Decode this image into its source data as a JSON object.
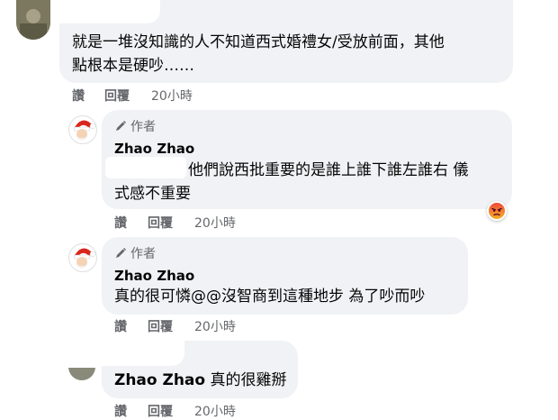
{
  "comments": [
    {
      "text_line1": "就是一堆沒知識的人不知道西式婚禮女/受放前面，其他",
      "text_line2": "點根本是硬吵……",
      "like": "讚",
      "reply": "回覆",
      "time": "20小時"
    },
    {
      "badge": "作者",
      "author": "Zhao Zhao",
      "text_line1": "他們說西批重要的是誰上誰下誰左誰右 儀",
      "text_line2": "式感不重要",
      "reaction": "angry",
      "like": "讚",
      "reply": "回覆",
      "time": "20小時"
    },
    {
      "badge": "作者",
      "author": "Zhao Zhao",
      "text_line1": "真的很可憐@@沒智商到這種地步 為了吵而吵",
      "like": "讚",
      "reply": "回覆",
      "time": "20小時"
    },
    {
      "author": "Zhao Zhao",
      "text_line1": "真的很雞掰",
      "like": "讚",
      "reply": "回覆",
      "time": "20小時"
    }
  ],
  "colors": {
    "bubble": "#f0f2f5",
    "secondary_text": "#65676b",
    "angry_reaction": "#e9710f"
  }
}
